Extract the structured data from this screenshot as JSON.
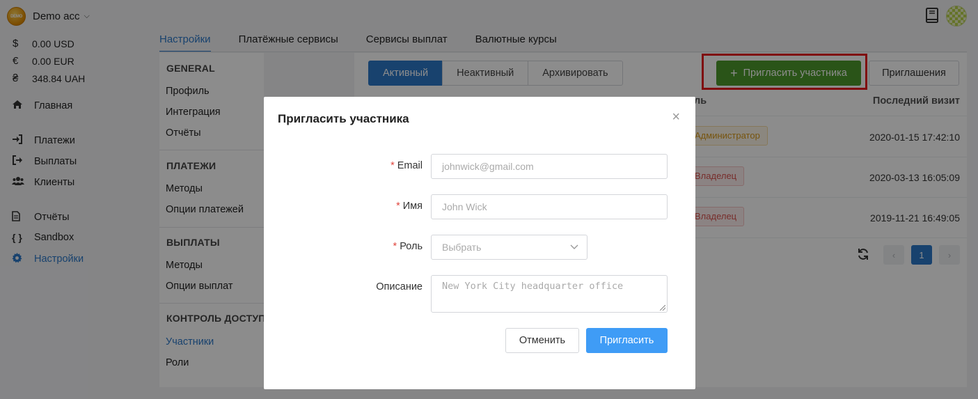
{
  "account": {
    "logo_text": "DEMO",
    "name": "Demo acc"
  },
  "balances": [
    {
      "symbol": "$",
      "amount": "0.00 USD"
    },
    {
      "symbol": "€",
      "amount": "0.00 EUR"
    },
    {
      "symbol": "₴",
      "amount": "348.84 UAH"
    }
  ],
  "nav": {
    "home": "Главная",
    "payments": "Платежи",
    "payouts": "Выплаты",
    "clients": "Клиенты",
    "reports": "Отчёты",
    "sandbox": "Sandbox",
    "settings": "Настройки"
  },
  "top_tabs": [
    "Настройки",
    "Платёжные сервисы",
    "Сервисы выплат",
    "Валютные курсы"
  ],
  "settings_menu": {
    "general": {
      "title": "GENERAL",
      "items": [
        "Профиль",
        "Интеграция",
        "Отчёты"
      ]
    },
    "payments": {
      "title": "ПЛАТЕЖИ",
      "items": [
        "Методы",
        "Опции платежей"
      ]
    },
    "payouts": {
      "title": "ВЫПЛАТЫ",
      "items": [
        "Методы",
        "Опции выплат"
      ]
    },
    "access": {
      "title": "КОНТРОЛЬ ДОСТУПА",
      "items": [
        "Участники",
        "Роли"
      ]
    }
  },
  "status_filter": [
    "Активный",
    "Неактивный",
    "Архивировать"
  ],
  "actions": {
    "invite_member": "Пригласить участника",
    "invitations": "Приглашения"
  },
  "table": {
    "col_role": "ль",
    "col_last_visit": "Последний визит",
    "rows": [
      {
        "role": "Администратор",
        "role_type": "admin",
        "last_visit": "2020-01-15 17:42:10"
      },
      {
        "role": "Владелец",
        "role_type": "owner",
        "last_visit": "2020-03-13 16:05:09"
      },
      {
        "role": "Владелец",
        "role_type": "owner",
        "last_visit": "2019-11-21 16:49:05"
      }
    ]
  },
  "pagination": {
    "current": "1",
    "prev": "‹",
    "next": "›"
  },
  "modal": {
    "title": "Пригласить участника",
    "close": "×",
    "email_label": "Email",
    "email_placeholder": "johnwick@gmail.com",
    "name_label": "Имя",
    "name_placeholder": "John Wick",
    "role_label": "Роль",
    "role_placeholder": "Выбрать",
    "description_label": "Описание",
    "description_placeholder": "New York City headquarter office",
    "required_mark": "*",
    "cancel": "Отменить",
    "submit": "Пригласить"
  },
  "colors": {
    "accent": "#2d78c8",
    "invite_green": "#4e9a2d",
    "submit_blue": "#3f9cf6",
    "highlight_red": "#e8161c"
  }
}
